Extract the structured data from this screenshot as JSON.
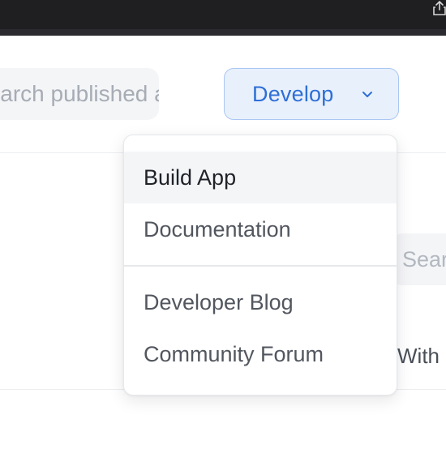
{
  "header": {
    "search_placeholder": "Search published apps",
    "develop_label": "Develop"
  },
  "dropdown": {
    "items": [
      {
        "label": "Build App",
        "active": true
      },
      {
        "label": "Documentation",
        "active": false
      },
      {
        "label": "Developer Blog",
        "active": false
      },
      {
        "label": "Community Forum",
        "active": false
      }
    ]
  },
  "background": {
    "search_fragment": "Search",
    "with_fragment": "With"
  },
  "colors": {
    "accent": "#2e6fd6",
    "accent_bg": "#e8f0fc",
    "chrome": "#1f1f22"
  },
  "icons": {
    "chevron": "chevron-down-icon",
    "share": "share-icon"
  }
}
